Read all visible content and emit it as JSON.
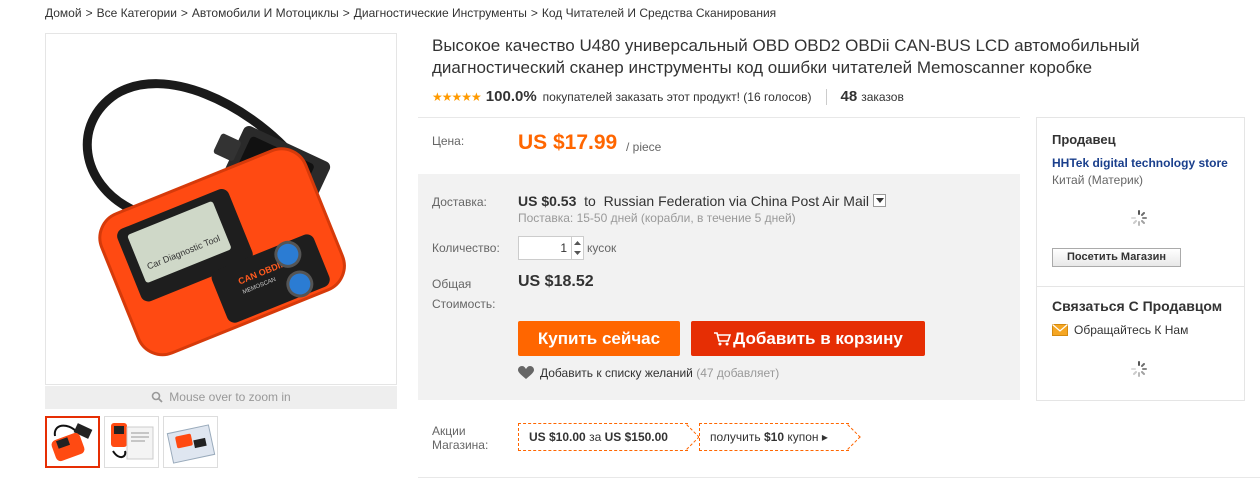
{
  "breadcrumb": [
    "Домой",
    "Все Категории",
    "Автомобили И Мотоциклы",
    "Диагностические Инструменты",
    "Код Читателей И Средства Сканирования"
  ],
  "gallery": {
    "zoom_hint": "Mouse over to zoom in",
    "main_image_alt": "OBD2 scanner",
    "device_screen_text": "Car Diagnostic Tool",
    "device_model": "CAN OBDII",
    "device_brand": "MEMOSCAN"
  },
  "product": {
    "title": "Высокое качество U480 универсальный OBD OBD2 OBDii CAN-BUS LCD автомобильный диагностический сканер инструменты код ошибки читателей Memoscanner коробке",
    "rating_stars": "★★★★★",
    "rating_pct": "100.0%",
    "votes_text": "покупателей заказать этот продукт! (16 голосов)",
    "orders_count": "48",
    "orders_label": "заказов"
  },
  "price": {
    "label": "Цена:",
    "value": "US $17.99",
    "unit": "/ piece"
  },
  "shipping": {
    "label": "Доставка:",
    "cost": "US $0.53",
    "to": "to",
    "destination": "Russian Federation via China Post Air Mail",
    "delivery_note": "Поставка: 15-50 дней (корабли, в течение 5 дней)"
  },
  "quantity": {
    "label": "Количество:",
    "value": "1",
    "unit": "кусок"
  },
  "total": {
    "label_line1": "Общая",
    "label_line2": "Стоимость:",
    "value": "US $18.52"
  },
  "actions": {
    "buy_now": "Купить сейчас",
    "add_to_cart": "Добавить в корзину",
    "wishlist": "Добавить к списку желаний",
    "wishlist_count": "(47 добавляет)"
  },
  "promo": {
    "label_line1": "Акции",
    "label_line2": "Магазина:",
    "coupon1_amount": "US $10.00",
    "coupon1_middle": "за",
    "coupon1_threshold": "US $150.00",
    "coupon2_prefix": "получить",
    "coupon2_amount": "$10",
    "coupon2_suffix": "купон ▸"
  },
  "seller": {
    "title": "Продавец",
    "store_name": "HHTek digital technology store",
    "location": "Китай (Материк)",
    "visit_button": "Посетить Магазин",
    "contact_title": "Связаться С Продавцом",
    "contact_link": "Обращайтесь К Нам"
  },
  "colors": {
    "price": "#ff6600",
    "buy_button": "#ff6600",
    "cart_button": "#e62e04",
    "store_link": "#1a3f8c",
    "stars": "#ff9a00"
  }
}
